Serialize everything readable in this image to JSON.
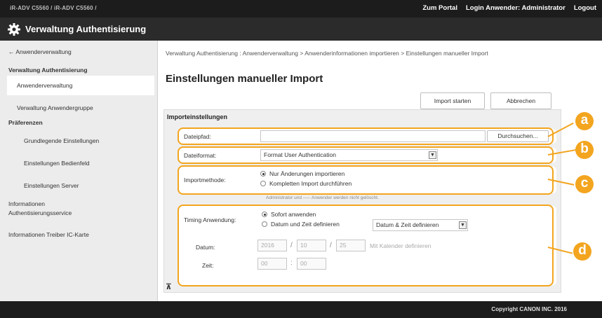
{
  "topbar": {
    "device": "iR-ADV C5560 / iR-ADV C5560 /",
    "portal": "Zum Portal",
    "login_label": "Login Anwender:",
    "login_user": "Administrator",
    "logout": "Logout"
  },
  "titlebar": {
    "title": "Verwaltung Authentisierung"
  },
  "sidebar": {
    "back": "← Anwenderverwaltung",
    "section_title": "Verwaltung Authentisierung",
    "items": [
      "Anwenderverwaltung",
      "Verwaltung Anwendergruppe"
    ],
    "group_title": "Präferenzen",
    "sub_items": [
      "Grundlegende Einstellungen",
      "Einstellungen Bedienfeld",
      "Einstellungen Server"
    ],
    "info_service_line1": "Informationen",
    "info_service_line2": "Authentisierungsservice",
    "info_driver": "Informationen Treiber IC-Karte"
  },
  "main": {
    "breadcrumb": "Verwaltung Authentisierung : Anwenderverwaltung > Anwenderinformationen importieren > Einstellungen manueller Import",
    "title": "Einstellungen manueller Import",
    "start_button": "Import starten",
    "cancel_button": "Abbrechen"
  },
  "import_settings": {
    "heading": "Importeinstellungen",
    "filepath_label": "Dateipfad:",
    "filepath_value": "",
    "browse_button": "Durchsuchen...",
    "fileformat_label": "Dateiformat:",
    "fileformat_value": "Format User Authentication",
    "method_label": "Importmethode:",
    "method_options": [
      "Nur Änderungen importieren",
      "Kompletten Import durchführen"
    ],
    "note": "Administrator und ----- Anwender werden nicht gelöscht.",
    "timing_label": "Timing Anwendung:",
    "timing_options": [
      "Sofort anwenden",
      "Datum und Zeit definieren"
    ],
    "timing_select": "Datum & Zeit definieren",
    "date_label": "Datum:",
    "date_year": "2016",
    "date_month": "10",
    "date_day": "25",
    "calendar_link": "Mit Kalender definieren",
    "time_label": "Zeit:",
    "time_hour": "00",
    "time_minute": "00"
  },
  "callouts": [
    "a",
    "b",
    "c",
    "d"
  ],
  "footer": {
    "copyright": "Copyright CANON INC. 2016"
  },
  "colors": {
    "accent": "#f3a51f",
    "topbar": "#1c1c1c",
    "sidebar": "#ececec"
  }
}
